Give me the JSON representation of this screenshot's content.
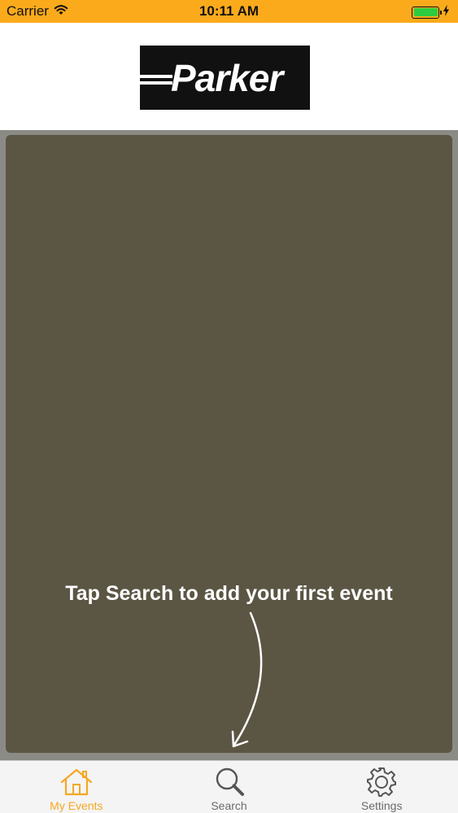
{
  "status_bar": {
    "carrier": "Carrier",
    "time": "10:11 AM",
    "battery_level": 1.0,
    "background_color": "#fbaa1b"
  },
  "header": {
    "logo_text": "Parker"
  },
  "main": {
    "prompt": "Tap Search to add your first event",
    "card_color": "#5b5544"
  },
  "tab_bar": {
    "active_color": "#f6a722",
    "tabs": [
      {
        "label": "My Events",
        "icon": "home-icon",
        "active": true
      },
      {
        "label": "Search",
        "icon": "search-icon",
        "active": false
      },
      {
        "label": "Settings",
        "icon": "gear-icon",
        "active": false
      }
    ]
  }
}
